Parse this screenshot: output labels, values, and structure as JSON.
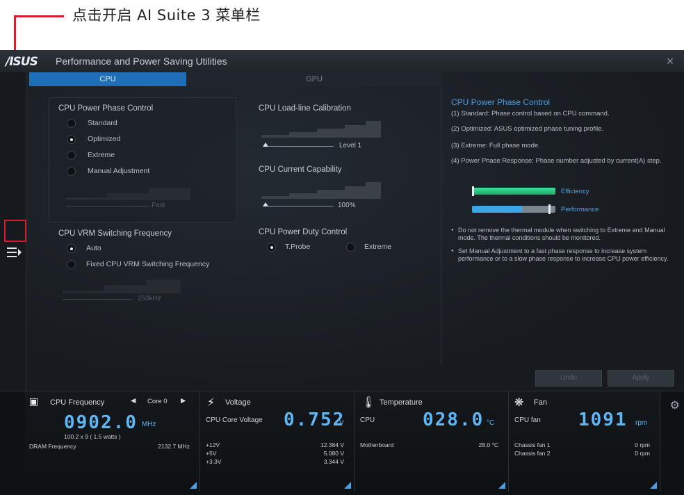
{
  "annotation": {
    "text": "点击开启 AI Suite 3 菜单栏"
  },
  "window": {
    "logo": "/ISUS",
    "title": "Performance and Power Saving Utilities",
    "close": "×"
  },
  "tabs": {
    "cpu": "CPU",
    "gpu": "GPU"
  },
  "phase_control": {
    "title": "CPU Power Phase Control",
    "options": [
      "Standard",
      "Optimized",
      "Extreme",
      "Manual Adjustment"
    ],
    "selected": 1,
    "slider_value": "Fast"
  },
  "vrm": {
    "title": "CPU VRM Switching Frequency",
    "options": [
      "Auto",
      "Fixed CPU VRM Switching Frequency"
    ],
    "selected": 0,
    "slider_value": "250kHz"
  },
  "llc": {
    "title": "CPU Load-line Calibration",
    "slider_value": "Level 1",
    "level": 0.02
  },
  "current_cap": {
    "title": "CPU Current Capability",
    "slider_value": "100%",
    "level": 0.02
  },
  "duty": {
    "title": "CPU Power Duty Control",
    "options": [
      "T.Probe",
      "Extreme"
    ],
    "selected": 0
  },
  "info": {
    "title": "CPU Power Phase Control",
    "lines": [
      "(1) Standard: Phase control based on CPU command.",
      "(2) Optimized: ASUS optimized phase tuning profile.",
      "(3) Extreme: Full phase mode.",
      "(4) Power Phase Response: Phase number adjusted by current(A) step."
    ],
    "efficiency_label": "Efficiency",
    "performance_label": "Performance",
    "efficiency_level": 0.0,
    "performance_level": 0.92,
    "bullets": [
      "Do not remove the thermal module when switching to Extreme and Manual mode. The thermal conditions should be monitored.",
      "Set Manual Adjustment to a fast phase response to increase system performance or to a slow phase response to increase CPU power efficiency."
    ]
  },
  "buttons": {
    "undo": "Undo",
    "apply": "Apply"
  },
  "status": {
    "cpu_freq": {
      "title": "CPU Frequency",
      "core": "Core 0",
      "value": "0902.0",
      "unit": "MHz",
      "sub": "100.2  x  9   ( 1.5    watts )",
      "dram_label": "DRAM Frequency",
      "dram_value": "2132.7  MHz"
    },
    "voltage": {
      "title": "Voltage",
      "core_label": "CPU Core Voltage",
      "value": "0.752",
      "unit": "V",
      "rows": [
        {
          "label": "+12V",
          "value": "12.384  V"
        },
        {
          "label": "+5V",
          "value": "5.080  V"
        },
        {
          "label": "+3.3V",
          "value": "3.344  V"
        }
      ]
    },
    "temperature": {
      "title": "Temperature",
      "cpu_label": "CPU",
      "value": "028.0",
      "unit": "°C",
      "mb_label": "Motherboard",
      "mb_value": "28.0 °C"
    },
    "fan": {
      "title": "Fan",
      "cpu_label": "CPU fan",
      "value": "1091",
      "unit": "rpm",
      "rows": [
        {
          "label": "Chassis fan 1",
          "value": "0  rpm"
        },
        {
          "label": "Chassis fan 2",
          "value": "0  rpm"
        }
      ]
    }
  }
}
